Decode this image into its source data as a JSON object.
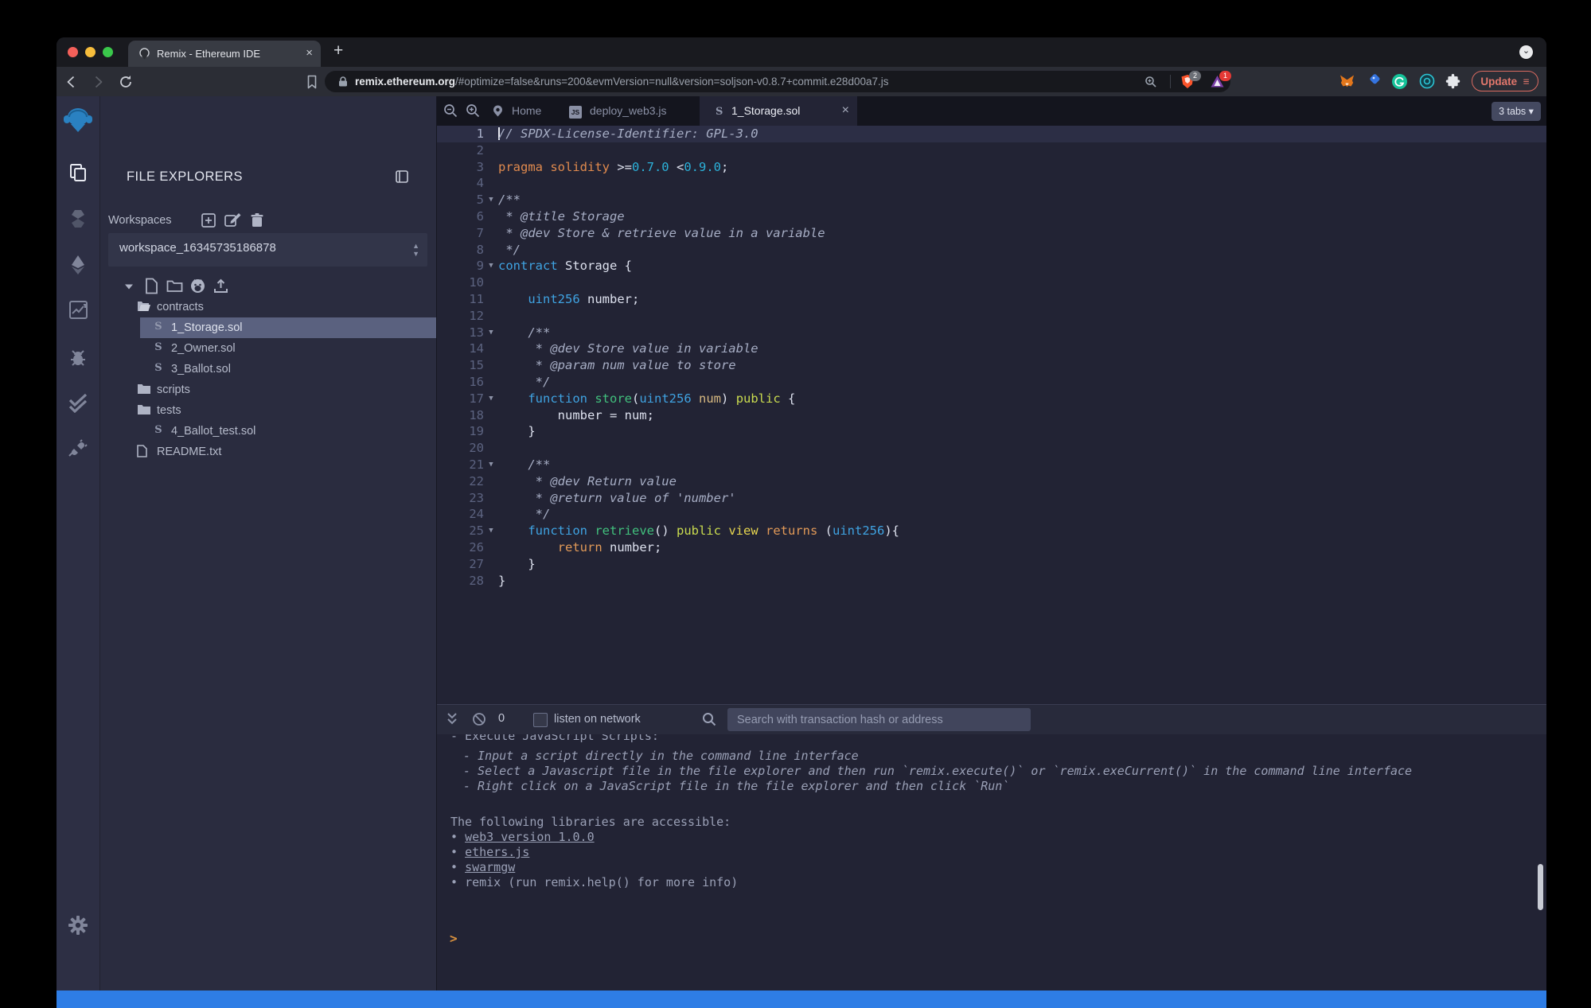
{
  "browser": {
    "tab_title": "Remix - Ethereum IDE",
    "new_tab_label": "+",
    "close_tab_label": "×",
    "url_domain": "remix.ethereum.org",
    "url_path": "/#optimize=false&runs=200&evmVersion=null&version=soljson-v0.8.7+commit.e28d00a7.js",
    "shield_badge": "2",
    "blocker_badge": "1",
    "update_label": "Update",
    "colors": {
      "update_accent": "#e2726a",
      "banner_blue": "#2e7de5"
    }
  },
  "sidebar": {
    "heading": "FILE EXPLORERS",
    "workspaces_label": "Workspaces",
    "workspace_name": "workspace_16345735186878",
    "tree": [
      {
        "label": "contracts",
        "icon": "folder-open",
        "level": 1
      },
      {
        "label": "1_Storage.sol",
        "icon": "solidity",
        "level": 2,
        "selected": true
      },
      {
        "label": "2_Owner.sol",
        "icon": "solidity",
        "level": 2
      },
      {
        "label": "3_Ballot.sol",
        "icon": "solidity",
        "level": 2
      },
      {
        "label": "scripts",
        "icon": "folder",
        "level": 1
      },
      {
        "label": "tests",
        "icon": "folder",
        "level": 1
      },
      {
        "label": "4_Ballot_test.sol",
        "icon": "solidity",
        "level": 2
      },
      {
        "label": "README.txt",
        "icon": "file",
        "level": 1
      }
    ]
  },
  "editor": {
    "tabs": [
      {
        "label": "Home",
        "icon": "remix"
      },
      {
        "label": "deploy_web3.js",
        "icon": "js"
      },
      {
        "label": "1_Storage.sol",
        "icon": "solidity",
        "active": true
      }
    ],
    "tabs_count_label": "3 tabs ▾",
    "code": {
      "language": "solidity",
      "lines": [
        {
          "n": 1,
          "hl": true,
          "cursor": true,
          "t": [
            [
              "c",
              "// SPDX-License-Identifier: GPL-3.0"
            ]
          ]
        },
        {
          "n": 2,
          "t": []
        },
        {
          "n": 3,
          "t": [
            [
              "o",
              "pragma solidity "
            ],
            [
              "p",
              ">="
            ],
            [
              "n",
              "0.7.0"
            ],
            [
              "p",
              " <"
            ],
            [
              "n",
              "0.9.0"
            ],
            [
              "p",
              ";"
            ]
          ]
        },
        {
          "n": 4,
          "t": []
        },
        {
          "n": 5,
          "fold": true,
          "t": [
            [
              "c",
              "/**"
            ]
          ]
        },
        {
          "n": 6,
          "t": [
            [
              "c",
              " * @title Storage"
            ]
          ]
        },
        {
          "n": 7,
          "t": [
            [
              "c",
              " * @dev Store & retrieve value in a variable"
            ]
          ]
        },
        {
          "n": 8,
          "t": [
            [
              "c",
              " */"
            ]
          ]
        },
        {
          "n": 9,
          "fold": true,
          "t": [
            [
              "k",
              "contract"
            ],
            [
              "p",
              " Storage {"
            ]
          ]
        },
        {
          "n": 10,
          "t": []
        },
        {
          "n": 11,
          "t": [
            [
              "p",
              "    "
            ],
            [
              "k",
              "uint256"
            ],
            [
              "p",
              " number;"
            ]
          ]
        },
        {
          "n": 12,
          "t": []
        },
        {
          "n": 13,
          "fold": true,
          "t": [
            [
              "c",
              "    /**"
            ]
          ]
        },
        {
          "n": 14,
          "t": [
            [
              "c",
              "     * @dev Store value in variable"
            ]
          ]
        },
        {
          "n": 15,
          "t": [
            [
              "c",
              "     * @param num value to store"
            ]
          ]
        },
        {
          "n": 16,
          "t": [
            [
              "c",
              "     */"
            ]
          ]
        },
        {
          "n": 17,
          "fold": true,
          "t": [
            [
              "p",
              "    "
            ],
            [
              "k",
              "function"
            ],
            [
              "p",
              " "
            ],
            [
              "f",
              "store"
            ],
            [
              "p",
              "("
            ],
            [
              "k",
              "uint256"
            ],
            [
              "p",
              " "
            ],
            [
              "a",
              "num"
            ],
            [
              "p",
              ") "
            ],
            [
              "u",
              "public"
            ],
            [
              "p",
              " {"
            ]
          ]
        },
        {
          "n": 18,
          "t": [
            [
              "p",
              "        number = num;"
            ]
          ]
        },
        {
          "n": 19,
          "t": [
            [
              "p",
              "    }"
            ]
          ]
        },
        {
          "n": 20,
          "t": []
        },
        {
          "n": 21,
          "fold": true,
          "t": [
            [
              "c",
              "    /**"
            ]
          ]
        },
        {
          "n": 22,
          "t": [
            [
              "c",
              "     * @dev Return value"
            ]
          ]
        },
        {
          "n": 23,
          "t": [
            [
              "c",
              "     * @return value of 'number'"
            ]
          ]
        },
        {
          "n": 24,
          "t": [
            [
              "c",
              "     */"
            ]
          ]
        },
        {
          "n": 25,
          "fold": true,
          "t": [
            [
              "p",
              "    "
            ],
            [
              "k",
              "function"
            ],
            [
              "p",
              " "
            ],
            [
              "f",
              "retrieve"
            ],
            [
              "p",
              "() "
            ],
            [
              "u",
              "public"
            ],
            [
              "p",
              " "
            ],
            [
              "v",
              "view"
            ],
            [
              "p",
              " "
            ],
            [
              "r",
              "returns"
            ],
            [
              "p",
              " ("
            ],
            [
              "k",
              "uint256"
            ],
            [
              "p",
              "){"
            ]
          ]
        },
        {
          "n": 26,
          "t": [
            [
              "p",
              "        "
            ],
            [
              "r",
              "return"
            ],
            [
              "p",
              " number;"
            ]
          ]
        },
        {
          "n": 27,
          "t": [
            [
              "p",
              "    }"
            ]
          ]
        },
        {
          "n": 28,
          "t": [
            [
              "p",
              "}"
            ]
          ]
        }
      ]
    }
  },
  "terminal": {
    "badge_count": "0",
    "listen_label": "listen on network",
    "search_placeholder": "Search with transaction hash or address",
    "prompt": ">",
    "lines": [
      {
        "kind": "clip",
        "text": "- Execute JavaScript Scripts:"
      },
      {
        "kind": "it",
        "text": "- Input a script directly in the command line interface"
      },
      {
        "kind": "it",
        "text": "- Select a Javascript file in the file explorer and then run `remix.execute()` or `remix.exeCurrent()` in the command line interface"
      },
      {
        "kind": "it",
        "text": "- Right click on a JavaScript file in the file explorer and then click `Run`"
      },
      {
        "kind": "spacer"
      },
      {
        "kind": "plain",
        "text": "The following libraries are accessible:"
      },
      {
        "kind": "link",
        "bullet": true,
        "text": "web3 version 1.0.0"
      },
      {
        "kind": "link",
        "bullet": true,
        "text": "ethers.js"
      },
      {
        "kind": "link",
        "bullet": true,
        "text": "swarmgw"
      },
      {
        "kind": "plain",
        "bullet": true,
        "text": "remix (run remix.help() for more info)"
      }
    ]
  }
}
